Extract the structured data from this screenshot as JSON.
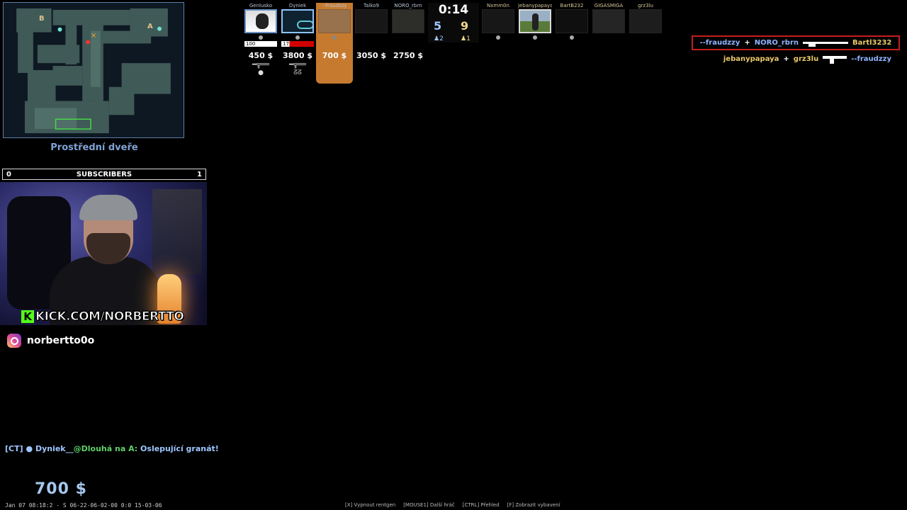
{
  "radar": {
    "location": "Prostřední dveře",
    "site_a": "A",
    "site_b": "B"
  },
  "stream": {
    "subscribers_left": "0",
    "subscribers_label": "SUBSCRIBERS",
    "subscribers_right": "1",
    "kick_icon": "K",
    "kick_url": "KICK.COM/NORBERTTO",
    "instagram_icon": "instagram-icon",
    "instagram_handle": "norbertto0o"
  },
  "scoreboard": {
    "ct_players": [
      {
        "name": "Genlusko",
        "hp": "100",
        "money": "450 $",
        "gun": "━╦══",
        "equip": "●"
      },
      {
        "name": "Dyniek",
        "hp": "17",
        "money": "3800 $",
        "gun": "━╦══",
        "equip": "ᘔᘔ"
      },
      {
        "name": "--fraudzzy",
        "hp": "",
        "money": "700 $",
        "gun": "",
        "equip": ""
      },
      {
        "name": "Talko9",
        "hp": "",
        "money": "3050 $",
        "gun": "",
        "equip": ""
      },
      {
        "name": "NORO_rbrn",
        "hp": "",
        "money": "2750 $",
        "gun": "",
        "equip": ""
      }
    ],
    "timer": "0:14",
    "score_ct": "5",
    "score_t": "9",
    "alive_ct": "♟2",
    "alive_t": "♟1",
    "t_players": [
      {
        "name": "Nxmm0n"
      },
      {
        "name": "jebanypapaya"
      },
      {
        "name": "BartB232"
      },
      {
        "name": "GIGASMIGA"
      },
      {
        "name": "grz3lu"
      }
    ]
  },
  "killfeed": [
    {
      "killer": "--fraudzzy",
      "assist": "NORO_rbrn",
      "victim": "Bartl3232",
      "weapon": "rifle-icon"
    },
    {
      "killer": "jebanypapaya",
      "assist": "grz3lu",
      "victim": "--fraudzzy",
      "weapon": "smg-icon"
    }
  ],
  "chat": {
    "team": "[CT]",
    "bullet": "●",
    "player": "Dyniek__",
    "location": "@Dlouhá na A:",
    "message": "Oslepující granát!"
  },
  "hud": {
    "money": "700 $",
    "demo_info": "Jan 07 08:18:2 - S 06-22-06-02-00 0:0 15-03-06",
    "hints": [
      "[X] Vypnout rentgen",
      "[MOUSE1] Další hráč",
      "[CTRL] Přehled",
      "[F] Zobrazit vybavení"
    ]
  },
  "colors": {
    "ct": "#8fb4ff",
    "t": "#e8c96a",
    "highlight": "#c67a2f",
    "kill_border": "#c41e1e"
  }
}
